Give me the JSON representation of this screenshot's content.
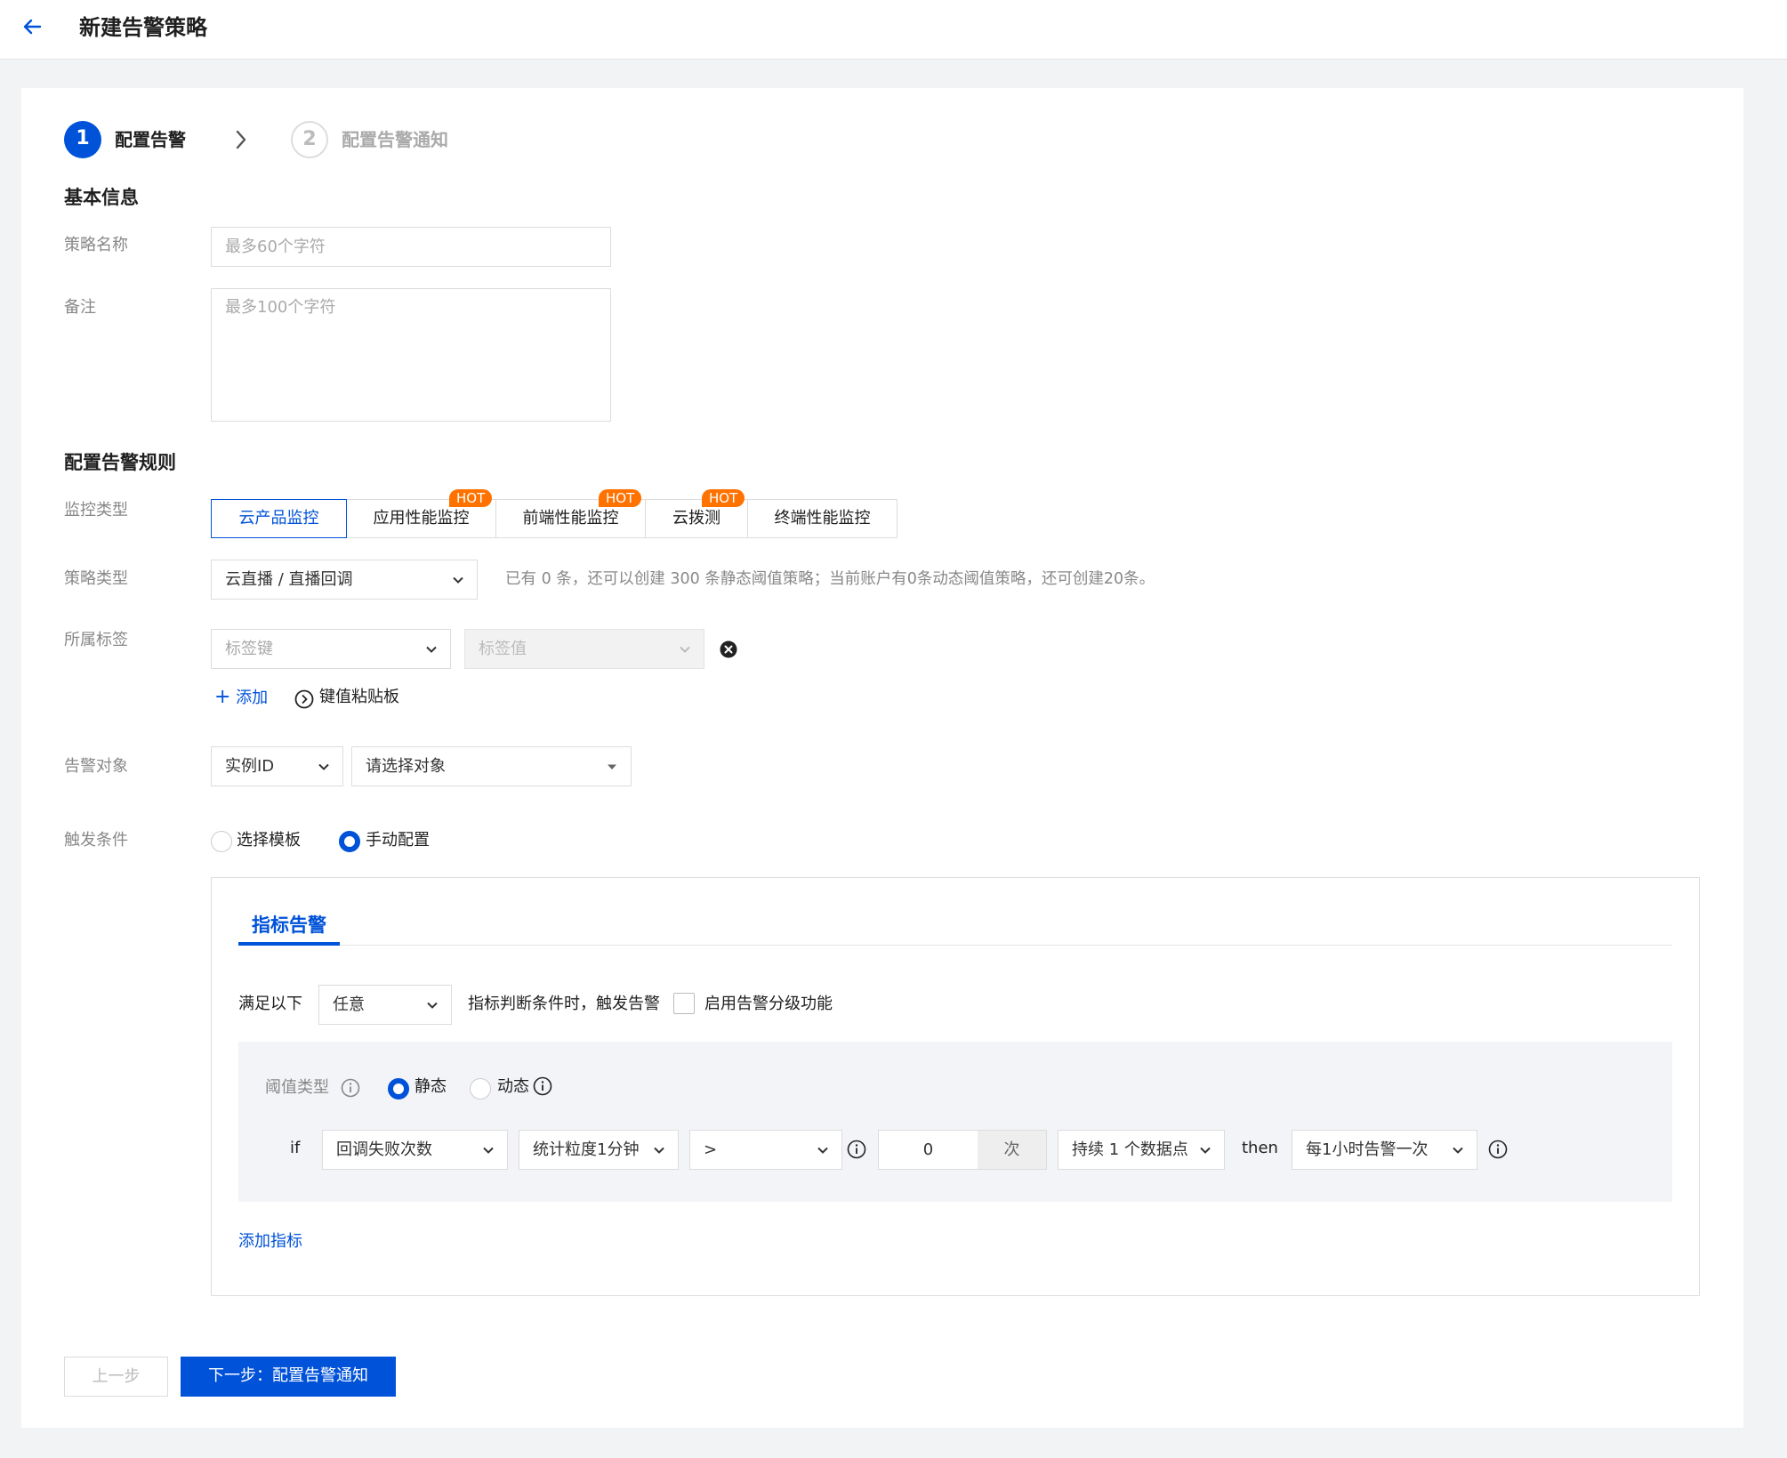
{
  "header": {
    "title": "新建告警策略",
    "back_icon": "arrow-left-icon"
  },
  "steps": [
    {
      "num": "1",
      "label": "配置告警",
      "state": "active"
    },
    {
      "num": "2",
      "label": "配置告警通知",
      "state": "inactive"
    }
  ],
  "basic": {
    "title": "基本信息",
    "name_label": "策略名称",
    "name_placeholder": "最多60个字符",
    "remark_label": "备注",
    "remark_placeholder": "最多100个字符"
  },
  "rules": {
    "title": "配置告警规则",
    "monitor_type_label": "监控类型",
    "monitor_types": [
      {
        "label": "云产品监控",
        "hot": false,
        "selected": true
      },
      {
        "label": "应用性能监控",
        "hot": true
      },
      {
        "label": "前端性能监控",
        "hot": true
      },
      {
        "label": "云拨测",
        "hot": true
      },
      {
        "label": "终端性能监控",
        "hot": false
      }
    ],
    "hot_badge": "HOT",
    "policy_type_label": "策略类型",
    "policy_type_value": "云直播 / 直播回调",
    "policy_hint": "已有 0 条，还可以创建 300 条静态阈值策略；当前账户有0条动态阈值策略，还可创建20条。",
    "tag_label": "所属标签",
    "tag_key_placeholder": "标签键",
    "tag_value_placeholder": "标签值",
    "add_label": "添加",
    "clipboard_label": "键值粘贴板",
    "target_label": "告警对象",
    "target_type": "实例ID",
    "target_placeholder": "请选择对象",
    "trigger_label": "触发条件",
    "trigger_options": [
      {
        "label": "选择模板",
        "selected": false
      },
      {
        "label": "手动配置",
        "selected": true
      }
    ]
  },
  "metric_panel": {
    "tab": "指标告警",
    "satisfy_prefix": "满足以下",
    "satisfy_value": "任意",
    "satisfy_suffix": "指标判断条件时，触发告警",
    "grading_label": "启用告警分级功能",
    "threshold_label": "阈值类型",
    "threshold_options": [
      {
        "label": "静态",
        "selected": true
      },
      {
        "label": "动态",
        "selected": false
      }
    ],
    "rule": {
      "if_label": "if",
      "metric": "回调失败次数",
      "granularity": "统计粒度1分钟",
      "operator": ">",
      "value": "0",
      "unit": "次",
      "duration": "持续 1 个数据点",
      "then_label": "then",
      "frequency": "每1小时告警一次"
    },
    "add_metric": "添加指标"
  },
  "footer": {
    "prev_label": "上一步",
    "next_label": "下一步：配置告警通知"
  }
}
